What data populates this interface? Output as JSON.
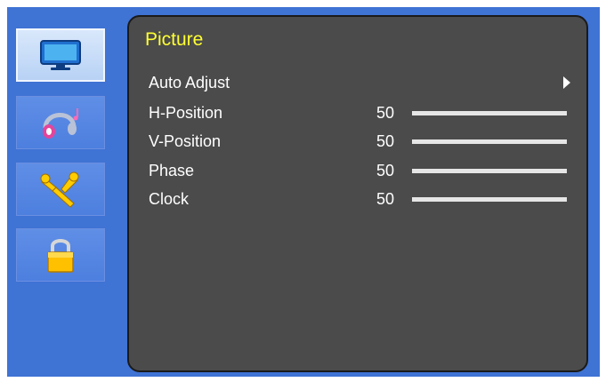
{
  "colors": {
    "frame": "#3f73d4",
    "panel": "#4b4b4b",
    "title": "#ffff33",
    "text": "#ffffff",
    "bar_fill": "#e6e6e6"
  },
  "sidebar": {
    "items": [
      {
        "name": "picture",
        "icon": "monitor-icon",
        "active": true
      },
      {
        "name": "audio",
        "icon": "headphones-icon",
        "active": false
      },
      {
        "name": "setup",
        "icon": "tools-icon",
        "active": false
      },
      {
        "name": "lock",
        "icon": "padlock-icon",
        "active": false
      }
    ]
  },
  "panel": {
    "title": "Picture",
    "auto_adjust": {
      "label": "Auto Adjust",
      "icon": "arrow-right-icon"
    },
    "rows": [
      {
        "label": "H-Position",
        "value": "50",
        "level": 1.0
      },
      {
        "label": "V-Position",
        "value": "50",
        "level": 1.0
      },
      {
        "label": "Phase",
        "value": "50",
        "level": 1.0
      },
      {
        "label": "Clock",
        "value": "50",
        "level": 1.0
      }
    ]
  }
}
